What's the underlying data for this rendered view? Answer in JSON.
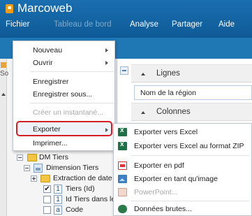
{
  "app": {
    "title": "Marcoweb"
  },
  "menubar": {
    "items": [
      {
        "label": "Fichier"
      },
      {
        "label": "Tableau de bord"
      },
      {
        "label": "Analyse"
      },
      {
        "label": "Partager"
      },
      {
        "label": "Aide"
      }
    ]
  },
  "left_edge": {
    "text": "So"
  },
  "right_panel": {
    "rows_section": "Lignes",
    "rows_field": "Nom de la région",
    "columns_section": "Colonnes"
  },
  "tree": {
    "items": [
      {
        "label": "DM Tiers"
      },
      {
        "label": "Dimension Tiers"
      },
      {
        "label": "Extraction de date"
      },
      {
        "label": "Tiers (Id)",
        "badge": "1",
        "checked": true
      },
      {
        "label": "Id Tiers dans le",
        "badge": "1",
        "checked": false
      },
      {
        "label": "Code",
        "badge": "a",
        "checked": false
      }
    ]
  },
  "file_menu": {
    "items": [
      {
        "label": "Nouveau",
        "submenu": true
      },
      {
        "label": "Ouvrir",
        "submenu": true
      },
      {
        "label": "Enregistrer"
      },
      {
        "label": "Enregistrer sous..."
      },
      {
        "label": "Créer un instantané...",
        "disabled": true
      },
      {
        "label": "Exporter",
        "submenu": true,
        "highlighted": true
      },
      {
        "label": "Imprimer..."
      }
    ]
  },
  "export_menu": {
    "items": [
      {
        "label": "Exporter vers Excel",
        "icon": "excel-icon"
      },
      {
        "label": "Exporter vers Excel au format ZIP",
        "icon": "excel-icon"
      },
      {
        "label": "Exporter en pdf",
        "icon": "pdf-icon"
      },
      {
        "label": "Exporter en tant qu'image",
        "icon": "image-icon"
      },
      {
        "label": "PowerPoint...",
        "icon": "powerpoint-icon",
        "disabled": true
      },
      {
        "label": "Données brutes...",
        "icon": "raw-data-icon"
      }
    ]
  },
  "colors": {
    "header_blue": "#1a6fb0",
    "highlight_red": "#d21f26",
    "logo_orange": "#f39c12"
  }
}
